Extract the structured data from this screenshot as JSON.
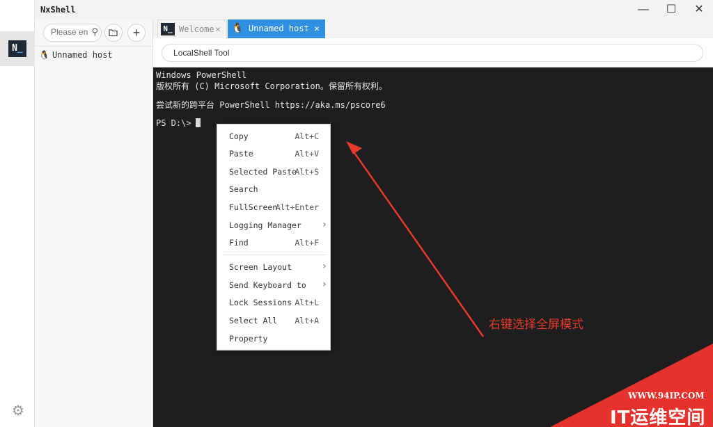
{
  "app": {
    "title": "NxShell"
  },
  "window": {
    "minimize": "—",
    "maximize": "☐",
    "close": "✕"
  },
  "rail": {
    "logo_n": "N",
    "logo_u": "_"
  },
  "sidebar": {
    "search_placeholder": "Please en",
    "hosts": [
      {
        "label": "Unnamed host",
        "icon": "tux-icon"
      }
    ]
  },
  "tabs": [
    {
      "label": "Welcome",
      "icon": "nxshell-logo",
      "active": false
    },
    {
      "label": "Unnamed host",
      "icon": "tux-icon",
      "active": true
    }
  ],
  "toolbar": {
    "local_tool_label": "LocalShell Tool"
  },
  "terminal": {
    "lines": [
      "Windows PowerShell",
      "版权所有 (C) Microsoft Corporation。保留所有权利。",
      "尝试新的跨平台 PowerShell https://aka.ms/pscore6",
      "PS D:\\>"
    ]
  },
  "context_menu": {
    "items": [
      {
        "label": "Copy",
        "shortcut": "Alt+C"
      },
      {
        "label": "Paste",
        "shortcut": "Alt+V"
      },
      {
        "label": "Selected Paste",
        "shortcut": "Alt+S"
      },
      {
        "label": "Search",
        "shortcut": ""
      },
      {
        "label": "FullScreen",
        "shortcut": "Alt+Enter"
      },
      {
        "label": "Logging Manager",
        "shortcut": "",
        "submenu": true
      },
      {
        "label": "Find",
        "shortcut": "Alt+F"
      },
      {
        "label": "Screen Layout",
        "shortcut": "",
        "submenu": true
      },
      {
        "label": "Send Keyboard to",
        "shortcut": "",
        "submenu": true
      },
      {
        "label": "Lock Sessions",
        "shortcut": "Alt+L"
      },
      {
        "label": "Select All",
        "shortcut": "Alt+A"
      },
      {
        "label": "Property",
        "shortcut": ""
      }
    ]
  },
  "annotation": {
    "text": "右键选择全屏模式",
    "color": "#e53a2a"
  },
  "watermark": {
    "url": "WWW.94IP.COM",
    "brand": "IT运维空间",
    "color": "#e5322d"
  },
  "colors": {
    "accent": "#2f8fe0",
    "terminal_bg": "#1e1e1e"
  }
}
